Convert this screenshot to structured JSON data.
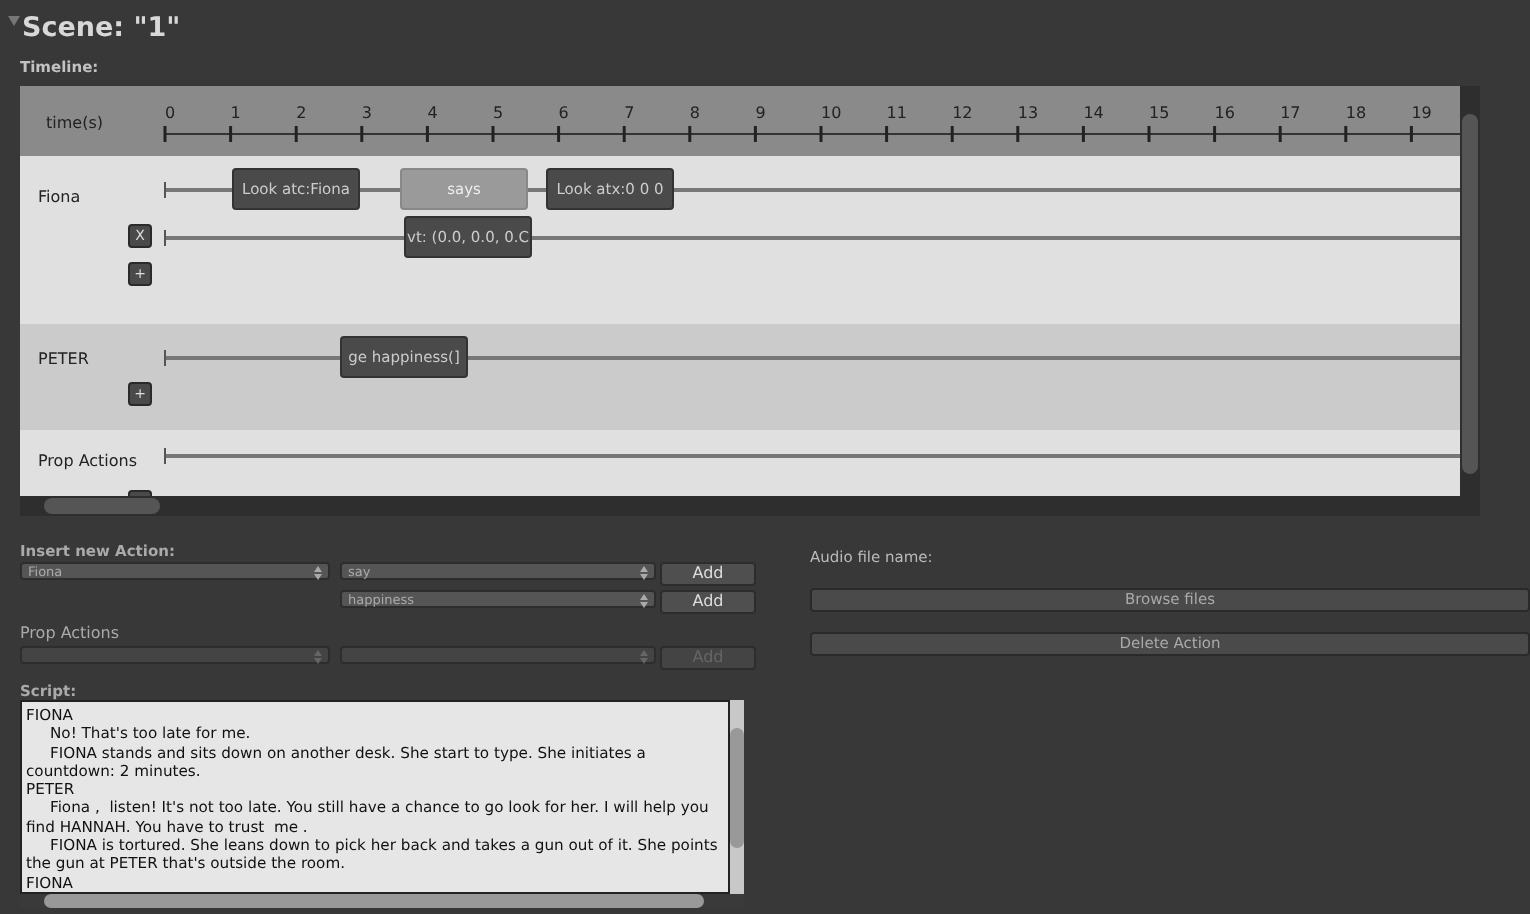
{
  "scene": {
    "title": "Scene: \"1\"",
    "expanded": true
  },
  "timeline": {
    "label": "Timeline:",
    "ruler_label": "time(s)",
    "ticks": [
      "0",
      "1",
      "2",
      "3",
      "4",
      "5",
      "6",
      "7",
      "8",
      "9",
      "10",
      "11",
      "12",
      "13",
      "14",
      "15",
      "16",
      "17",
      "18",
      "19"
    ],
    "tracks": [
      {
        "name": "Fiona",
        "lines": [
          {
            "actions": [
              {
                "label": "Look atc:Fiona",
                "selected": false
              },
              {
                "label": "says",
                "selected": true
              },
              {
                "label": "Look atx:0 0 0",
                "selected": false
              }
            ]
          },
          {
            "remove_button": "X",
            "actions": [
              {
                "label": "vt: (0.0, 0.0, 0.C",
                "selected": false
              }
            ]
          }
        ],
        "add_button": "+"
      },
      {
        "name": "PETER",
        "lines": [
          {
            "actions": [
              {
                "label": "ge happiness(]",
                "selected": false
              }
            ]
          }
        ],
        "add_button": "+"
      },
      {
        "name": "Prop Actions"
      }
    ]
  },
  "insert": {
    "label": "Insert new Action:",
    "actor_select": "Fiona",
    "action_select": "say",
    "add_button": "Add",
    "parameter_select": "happiness",
    "parameter_add_button": "Add"
  },
  "prop_actions": {
    "label": "Prop Actions",
    "add_button": "Add",
    "disabled": true
  },
  "script": {
    "label": "Script:",
    "lines": [
      {
        "kind": "character",
        "text": "FIONA"
      },
      {
        "kind": "line",
        "text": "No! That's too late for me."
      },
      {
        "kind": "line",
        "text": "FIONA stands and sits down on another desk. She start to type. She initiates a countdown: 2 minutes."
      },
      {
        "kind": "character",
        "text": "PETER"
      },
      {
        "kind": "line",
        "text": "Fiona ,  listen! It's not too late. You still have a chance to go look for her. I will help you find HANNAH. You have to trust  me ."
      },
      {
        "kind": "line",
        "text": "FIONA is tortured. She leans down to pick her back and takes a gun out of it. She points the gun at PETER that's outside the room."
      },
      {
        "kind": "character",
        "text": "FIONA"
      }
    ]
  },
  "audio": {
    "label": "Audio file name:",
    "browse_button": "Browse files",
    "delete_button": "Delete Action"
  }
}
